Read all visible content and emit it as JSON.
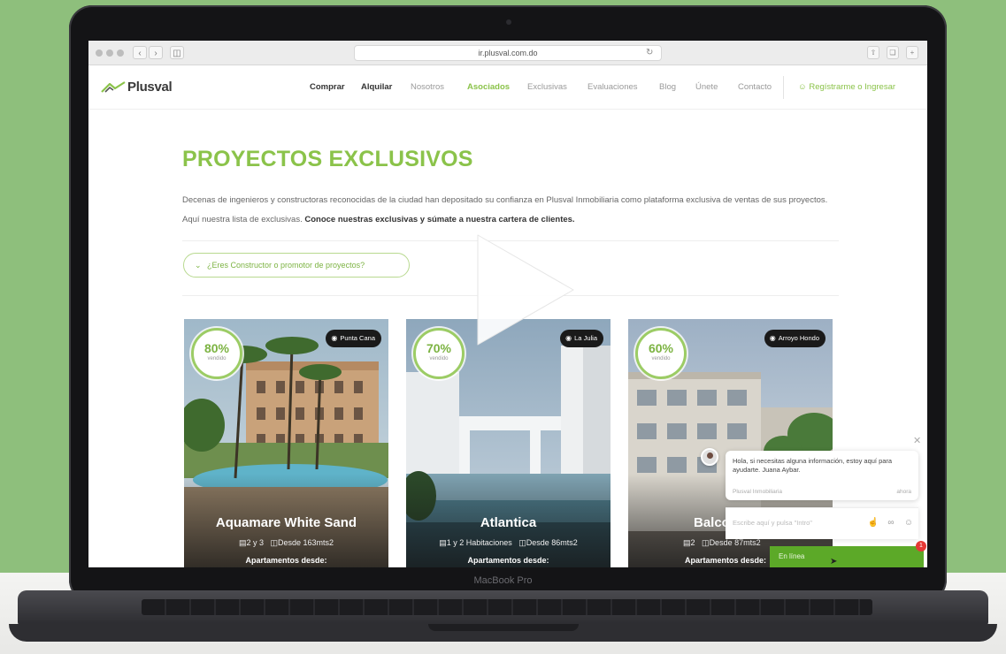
{
  "browser": {
    "url": "ir.plusval.com.do"
  },
  "site": {
    "logo_text": "Plusval",
    "nav": [
      {
        "label": "Comprar",
        "color": "#333333"
      },
      {
        "label": "Alquilar",
        "color": "#333333"
      },
      {
        "label": "Nosotros",
        "color": "#9a9a9a"
      },
      {
        "label": "Asociados",
        "color": "#8bc34a"
      },
      {
        "label": "Exclusivas",
        "color": "#9a9a9a"
      },
      {
        "label": "Evaluaciones",
        "color": "#9a9a9a"
      },
      {
        "label": "Blog",
        "color": "#9a9a9a"
      },
      {
        "label": "Únete",
        "color": "#9a9a9a"
      },
      {
        "label": "Contacto",
        "color": "#9a9a9a"
      }
    ],
    "register": "Regístrarme o Ingresar"
  },
  "main": {
    "title": "PROYECTOS EXCLUSIVOS",
    "intro_plain": "Decenas de ingenieros y constructoras reconocidas de la ciudad han depositado su confianza en Plusval Inmobiliaria como plataforma exclusiva de ventas de sus proyectos. Aquí nuestra lista de exclusivas.",
    "intro_bold": "Conoce nuestras exclusivas y súmate a nuestra cartera de clientes.",
    "toggle": "¿Eres Constructor o promotor de proyectos?"
  },
  "cards": [
    {
      "pct": "80%",
      "sold": "vendido",
      "location": "Punta Cana",
      "name": "Aquamare White Sand",
      "rooms": "2 y 3",
      "size": "Desde 163mts2",
      "from": "Apartamentos desde:"
    },
    {
      "pct": "70%",
      "sold": "vendido",
      "location": "La Julia",
      "name": "Atlantica",
      "rooms": "1 y 2 Habitaciones",
      "size": "Desde 86mts2",
      "from": "Apartamentos desde:"
    },
    {
      "pct": "60%",
      "sold": "vendido",
      "location": "Arroyo Hondo",
      "name": "Balcones",
      "rooms": "2",
      "size": "Desde 87mts2",
      "from": "Apartamentos desde:"
    }
  ],
  "chat": {
    "message": "Hola, si necesitas alguna información, estoy aquí para ayudarte. Juana Aybar.",
    "sender": "Plusval Inmobiliaria",
    "time": "ahora",
    "input_placeholder": "Escribe aquí y pulsa \"Intro\"",
    "tab_label": "En línea",
    "badge": "1"
  },
  "laptop": {
    "model_label": "MacBook Pro"
  },
  "colors": {
    "accent": "#8bc34a",
    "chat_green": "#5ca928",
    "background": "#8ebf7c"
  },
  "icons": [
    "back-arrow-icon",
    "forward-arrow-icon",
    "reload-icon",
    "share-icon",
    "play-icon",
    "location-pin-icon",
    "bed-icon",
    "area-icon",
    "close-icon",
    "thumbs-up-icon",
    "attach-icon",
    "emoji-icon",
    "chevron-down-icon",
    "user-icon",
    "cursor-icon"
  ]
}
